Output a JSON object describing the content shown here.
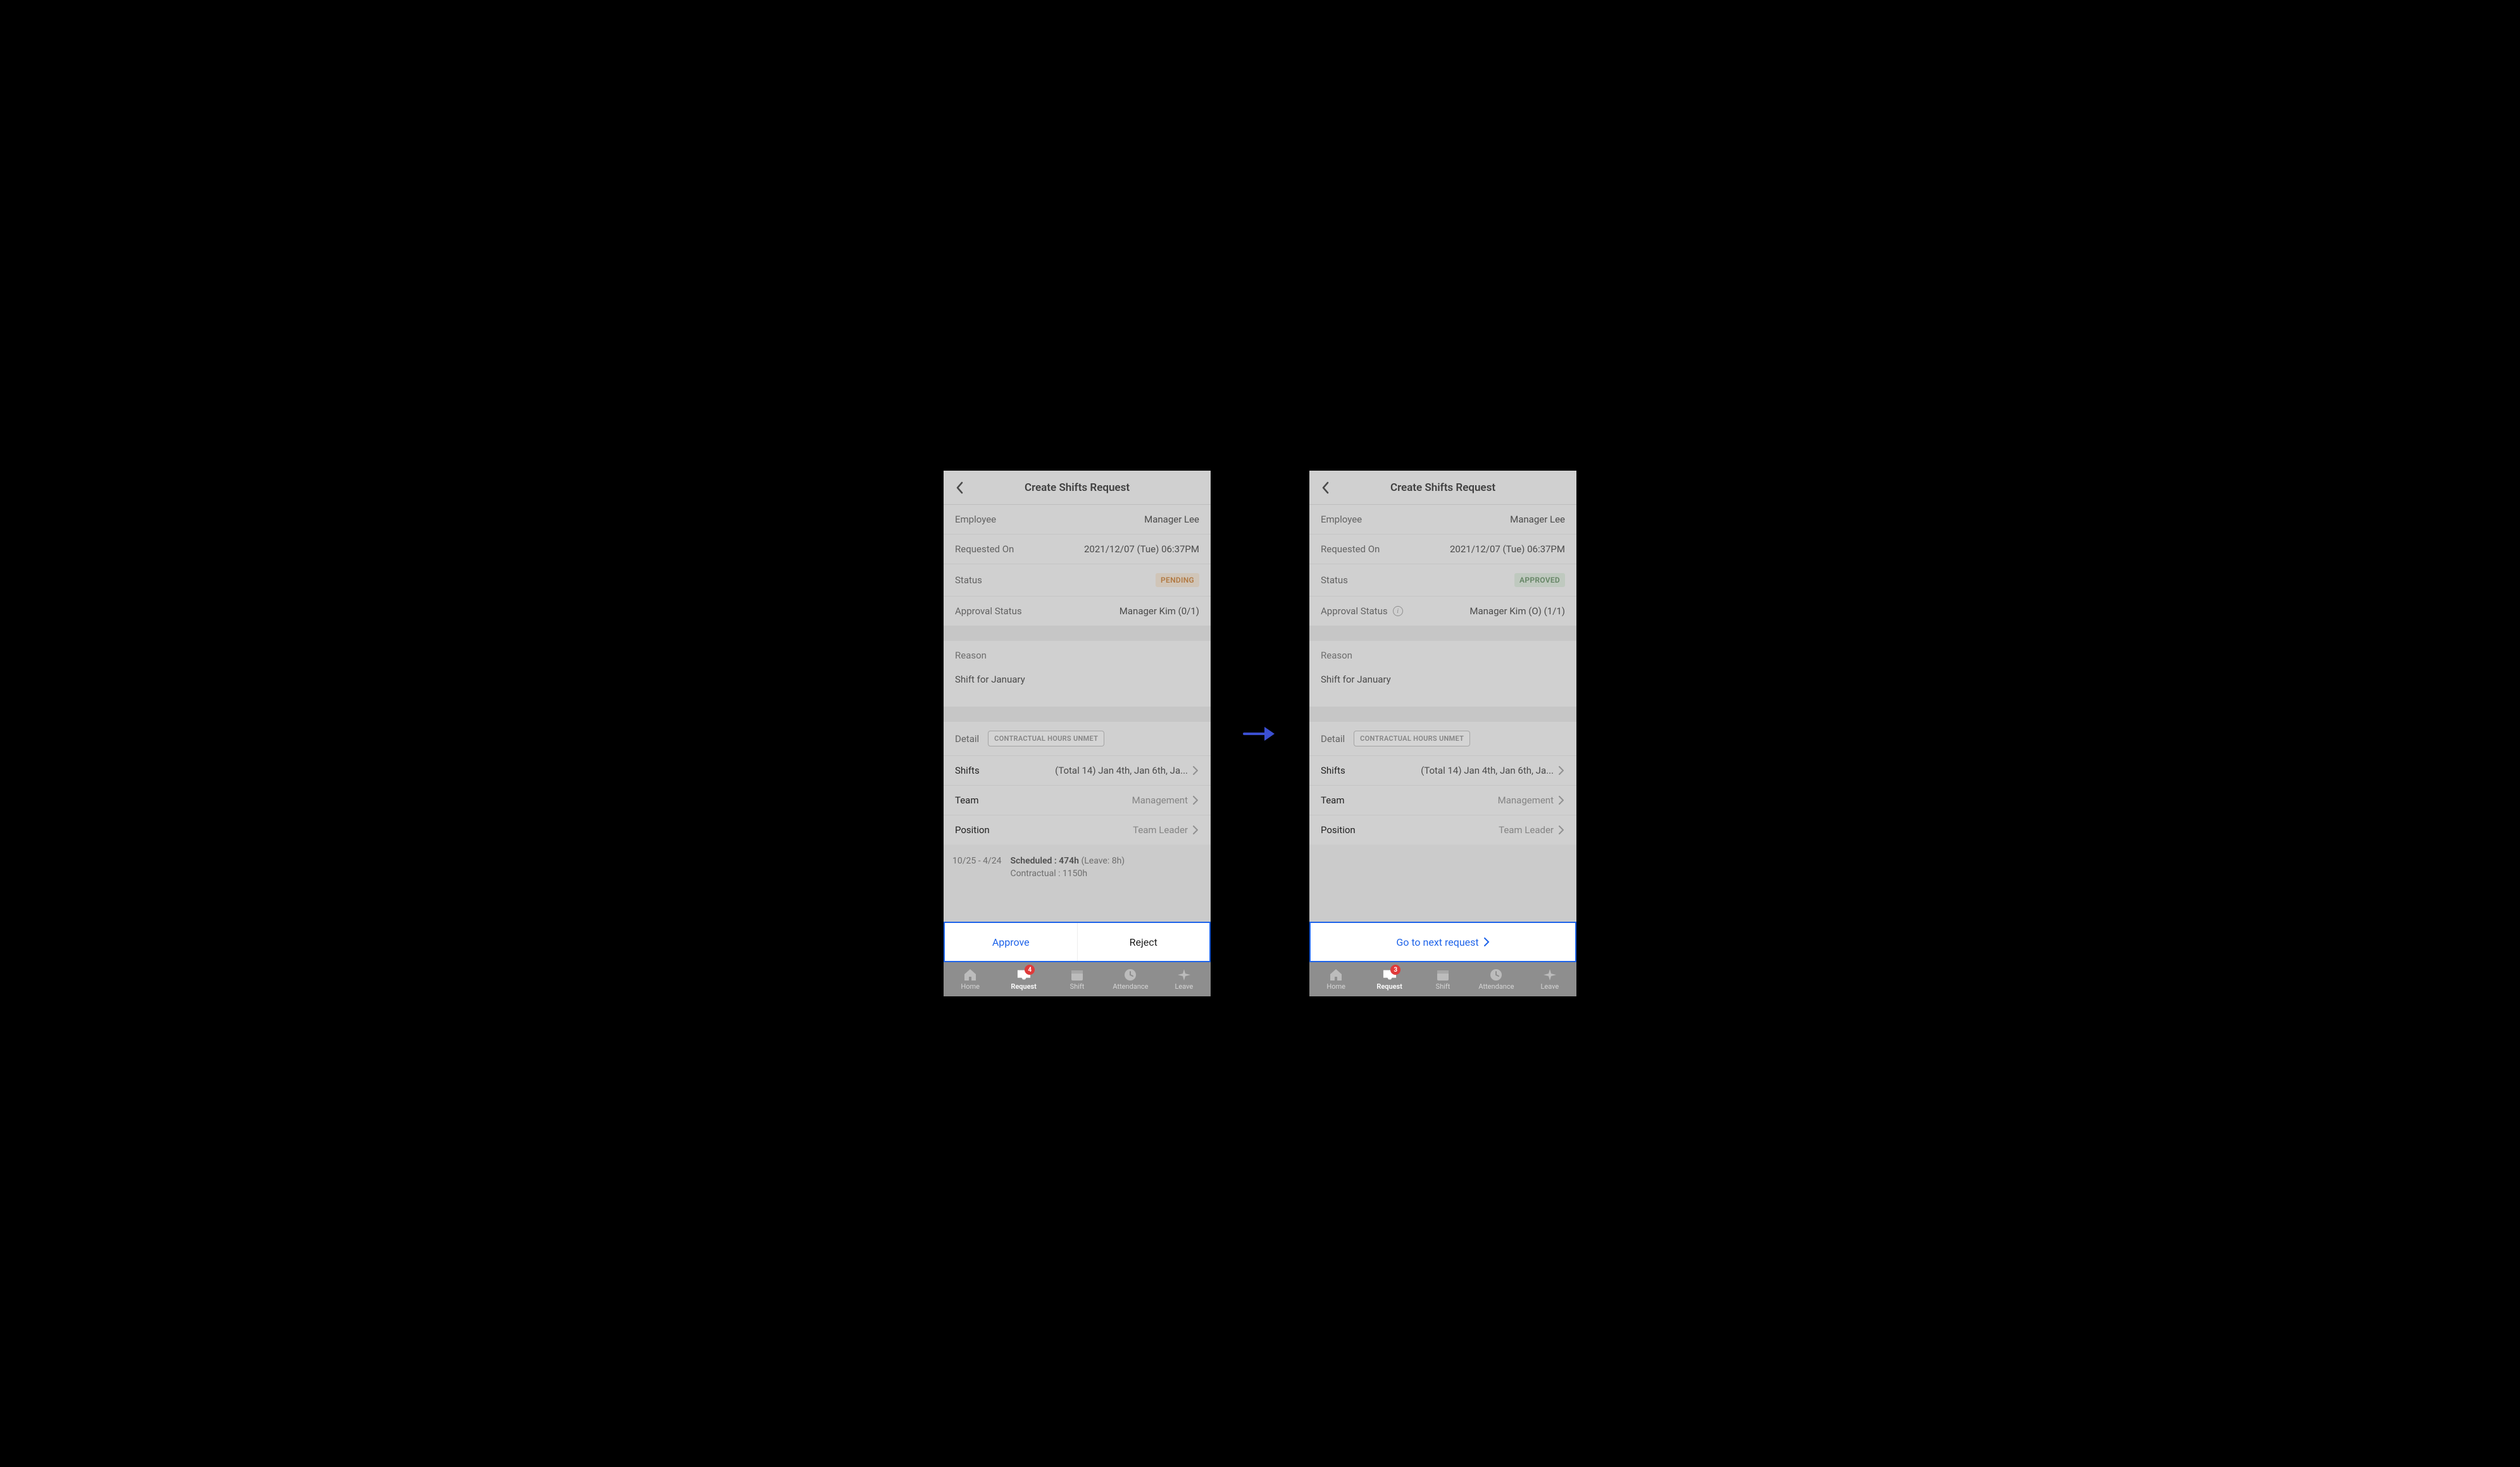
{
  "left": {
    "header": {
      "title": "Create Shifts Request"
    },
    "rows": {
      "employee_label": "Employee",
      "employee_value": "Manager Lee",
      "requested_on_label": "Requested On",
      "requested_on_value": "2021/12/07 (Tue) 06:37PM",
      "status_label": "Status",
      "status_badge": "PENDING",
      "approval_label": "Approval Status",
      "approval_value": "Manager Kim (0/1)"
    },
    "reason": {
      "label": "Reason",
      "text": "Shift for January"
    },
    "detail": {
      "label": "Detail",
      "chip": "CONTRACTUAL HOURS UNMET",
      "shifts_label": "Shifts",
      "shifts_value": "(Total 14) Jan 4th, Jan 6th, Ja...",
      "team_label": "Team",
      "team_value": "Management",
      "position_label": "Position",
      "position_value": "Team Leader"
    },
    "footer": {
      "range": "10/25 - 4/24",
      "scheduled_label": "Scheduled : 474h",
      "scheduled_leave": "(Leave: 8h)",
      "contractual": "Contractual : 1150h"
    },
    "actions": {
      "approve": "Approve",
      "reject": "Reject"
    },
    "tabs": {
      "home": "Home",
      "request": "Request",
      "shift": "Shift",
      "attendance": "Attendance",
      "leave": "Leave",
      "badge": "4"
    }
  },
  "right": {
    "header": {
      "title": "Create Shifts Request"
    },
    "rows": {
      "employee_label": "Employee",
      "employee_value": "Manager Lee",
      "requested_on_label": "Requested On",
      "requested_on_value": "2021/12/07 (Tue) 06:37PM",
      "status_label": "Status",
      "status_badge": "APPROVED",
      "approval_label": "Approval Status",
      "approval_value": "Manager Kim (O) (1/1)"
    },
    "reason": {
      "label": "Reason",
      "text": "Shift for January"
    },
    "detail": {
      "label": "Detail",
      "chip": "CONTRACTUAL HOURS UNMET",
      "shifts_label": "Shifts",
      "shifts_value": "(Total 14) Jan 4th, Jan 6th, Ja...",
      "team_label": "Team",
      "team_value": "Management",
      "position_label": "Position",
      "position_value": "Team Leader"
    },
    "actions": {
      "next": "Go to next request"
    },
    "tabs": {
      "home": "Home",
      "request": "Request",
      "shift": "Shift",
      "attendance": "Attendance",
      "leave": "Leave",
      "badge": "3"
    }
  }
}
